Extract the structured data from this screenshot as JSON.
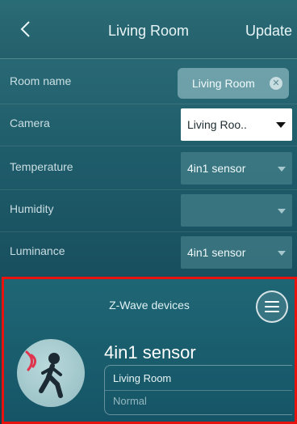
{
  "header": {
    "title": "Living Room",
    "update_label": "Update"
  },
  "form": {
    "room_name": {
      "label": "Room name",
      "value": "Living Room"
    },
    "camera": {
      "label": "Camera",
      "value": "Living Roo.."
    },
    "temperature": {
      "label": "Temperature",
      "value": "4in1 sensor"
    },
    "humidity": {
      "label": "Humidity",
      "value": ""
    },
    "luminance": {
      "label": "Luminance",
      "value": "4in1 sensor"
    }
  },
  "zwave": {
    "title": "Z-Wave devices",
    "device": {
      "name": "4in1 sensor",
      "room": "Living Room",
      "status": "Normal"
    }
  },
  "colors": {
    "highlight_border": "#e8120f",
    "motion_waves": "#e0334d",
    "figure": "#1c2b33"
  }
}
